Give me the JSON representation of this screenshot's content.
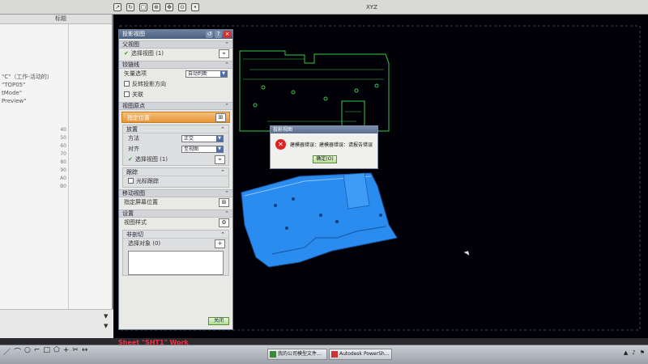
{
  "toolbar": {
    "coord_text": "XYZ"
  },
  "navigator": {
    "header_label": "标题",
    "lines": [
      "\"C\"（工作-活动的）",
      "\"TOP05\"",
      "tMode\"",
      "Preview\""
    ],
    "row_numbers": [
      "40",
      "50",
      "60",
      "70",
      "80",
      "90",
      "A0",
      "B0"
    ]
  },
  "dialog": {
    "title": "投影视图",
    "parent_view": {
      "header": "父视图",
      "select_label": "选择视图 (1)"
    },
    "hinge_line": {
      "header": "铰链线",
      "vector_label": "矢量选项",
      "vector_value": "自动判断",
      "reverse_label": "反转投影方向",
      "associative_label": "关联"
    },
    "view_origin": {
      "header": "视图原点",
      "specify_location": "指定位置",
      "placement": {
        "header": "放置",
        "method_label": "方法",
        "method_value": "正交",
        "alignment_label": "对齐",
        "alignment_value": "至视图",
        "select_view": "选择视图 (1)"
      },
      "tracking": {
        "header": "跟踪",
        "cursor_tracking": "光标跟踪"
      }
    },
    "move_view": {
      "header": "移动视图",
      "specify_screen": "指定屏幕位置"
    },
    "settings": {
      "header": "设置",
      "view_style": "视图样式",
      "non_sectioned": {
        "header": "非剖切",
        "select_object": "选择对象 (0)"
      }
    },
    "ok_label": "关闭"
  },
  "error_dialog": {
    "title": "投影视图",
    "message": "建模器错误：建模器错误：请报告错误",
    "ok_label": "确定(O)"
  },
  "status": {
    "sheet_label": "Sheet \"SHT1\" Work"
  },
  "taskbar": {
    "items": [
      "我的公司模型文件... ",
      "Autodesk PowerSh..."
    ]
  },
  "colors": {
    "part_fill": "#2b8cf0",
    "wire_green": "#36c84a",
    "canvas_bg": "#000006"
  }
}
